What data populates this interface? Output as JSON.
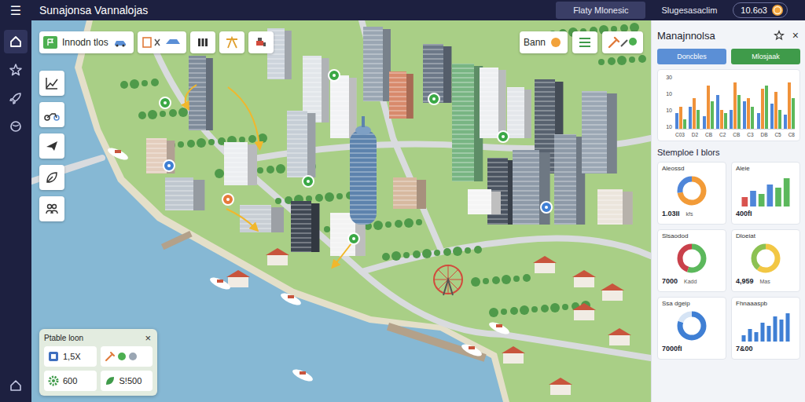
{
  "window": {
    "title": "Sunajonsa Vannalojas",
    "menu_icon": "☰"
  },
  "top_bar": {
    "tabs": [
      {
        "label": "Flaty Mlonesic",
        "selected": true
      },
      {
        "label": "Slugesasaclim",
        "selected": false
      }
    ],
    "currency": "10.6o3"
  },
  "sidebar": {
    "items": [
      {
        "selected": true
      },
      {
        "selected": false
      },
      {
        "selected": false
      },
      {
        "selected": false
      }
    ],
    "footer_item": {
      "selected": false
    }
  },
  "map_toolbar": {
    "label": "Innodn tlos"
  },
  "map_actions": {
    "label": "Bann"
  },
  "quick_panel": {
    "title": "Ptable loon",
    "close": "×",
    "stats": [
      "1,5X",
      "600",
      "S!500"
    ]
  },
  "side_panel": {
    "title": "Manajnnolsa",
    "close": "×",
    "buttons": [
      {
        "label": "Doncbles",
        "color": "#5b8fd6"
      },
      {
        "label": "Mlosjaak",
        "color": "#3f9b4a"
      }
    ],
    "chart": {
      "y_ticks": [
        "30",
        "10",
        "10",
        "10"
      ],
      "x_labels": [
        "C03",
        "D2",
        "CB",
        "C2",
        "CB",
        "C3",
        "DB",
        "C5",
        "C8"
      ],
      "series": [
        {
          "color": "#4f86d9",
          "values": [
            10,
            14,
            8,
            22,
            12,
            18,
            10,
            16,
            9
          ]
        },
        {
          "color": "#f0923a",
          "values": [
            14,
            20,
            28,
            12,
            30,
            20,
            26,
            24,
            30
          ]
        },
        {
          "color": "#5cb85c",
          "values": [
            6,
            12,
            18,
            10,
            22,
            14,
            28,
            12,
            20
          ]
        }
      ]
    },
    "section_title": "Stemploe I blors",
    "cards": [
      {
        "title": "Aleossd",
        "kind": "donut",
        "value": "1.03II",
        "unit": "kfs",
        "segments": [
          {
            "value": 72,
            "color": "#f29b38"
          },
          {
            "value": 28,
            "color": "#4f86d9"
          }
        ]
      },
      {
        "title": "Aleie",
        "kind": "bars",
        "value": "400fI",
        "bars": [
          {
            "value": 3,
            "color": "#d9534f"
          },
          {
            "value": 5,
            "color": "#4f86d9"
          },
          {
            "value": 4,
            "color": "#5cb85c"
          },
          {
            "value": 7,
            "color": "#4f86d9"
          },
          {
            "value": 6,
            "color": "#5cb85c"
          },
          {
            "value": 9,
            "color": "#5cb85c"
          }
        ]
      },
      {
        "title": "Slsaodod",
        "kind": "donut",
        "value": "7000",
        "unit": "Kadd",
        "segments": [
          {
            "value": 55,
            "color": "#5cb85c"
          },
          {
            "value": 45,
            "color": "#c9414b"
          }
        ]
      },
      {
        "title": "Dloeiat",
        "kind": "donut",
        "value": "4,959",
        "unit": "Mas",
        "segments": [
          {
            "value": 60,
            "color": "#f2c744"
          },
          {
            "value": 40,
            "color": "#8cc152"
          }
        ]
      },
      {
        "title": "Ssa dgeip",
        "kind": "donut",
        "value": "7000fI",
        "segments": [
          {
            "value": 80,
            "color": "#3f7fd4"
          },
          {
            "value": 20,
            "color": "#d6e4f5"
          }
        ]
      },
      {
        "title": "Fhnaaaspb",
        "kind": "bars",
        "value": "7&00",
        "bars": [
          {
            "value": 2,
            "color": "#3f7fd4"
          },
          {
            "value": 4,
            "color": "#3f7fd4"
          },
          {
            "value": 3,
            "color": "#3f7fd4"
          },
          {
            "value": 6,
            "color": "#3f7fd4"
          },
          {
            "value": 5,
            "color": "#3f7fd4"
          },
          {
            "value": 8,
            "color": "#3f7fd4"
          },
          {
            "value": 7,
            "color": "#3f7fd4"
          },
          {
            "value": 9,
            "color": "#3f7fd4"
          }
        ]
      }
    ]
  }
}
